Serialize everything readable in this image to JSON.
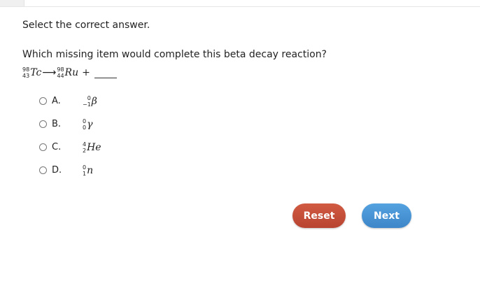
{
  "instruction": "Select the correct answer.",
  "question": "Which missing item would complete this beta decay reaction?",
  "equation": {
    "reactant": {
      "mass": "98",
      "atomic": "43",
      "symbol": "Tc"
    },
    "arrow": "⟶",
    "product": {
      "mass": "98",
      "atomic": "44",
      "symbol": "Ru"
    },
    "plus": "+"
  },
  "options": [
    {
      "letter": "A.",
      "mass": "0",
      "atomic": "−1",
      "symbol": "β"
    },
    {
      "letter": "B.",
      "mass": "0",
      "atomic": "0",
      "symbol": "γ"
    },
    {
      "letter": "C.",
      "mass": "4",
      "atomic": "2",
      "symbol": "He"
    },
    {
      "letter": "D.",
      "mass": "0",
      "atomic": "1",
      "symbol": "n"
    }
  ],
  "buttons": {
    "reset": "Reset",
    "next": "Next"
  },
  "colors": {
    "reset": "#c44e39",
    "next": "#4a94d6"
  }
}
